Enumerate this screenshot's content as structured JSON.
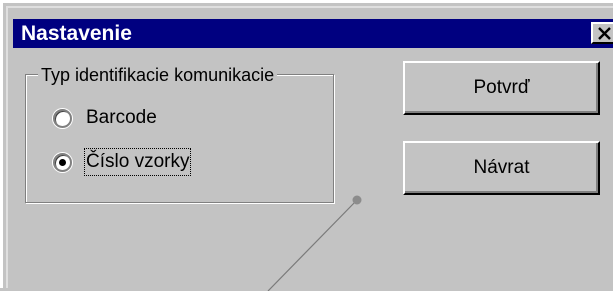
{
  "window": {
    "title": "Nastavenie",
    "close_icon": "close-icon"
  },
  "group": {
    "legend": "Typ identifikacie komunikacie",
    "options": [
      {
        "label": "Barcode",
        "selected": false
      },
      {
        "label": "Číslo vzorky",
        "selected": true
      }
    ]
  },
  "buttons": {
    "confirm_label": "Potvrď",
    "back_label": "Návrat"
  }
}
